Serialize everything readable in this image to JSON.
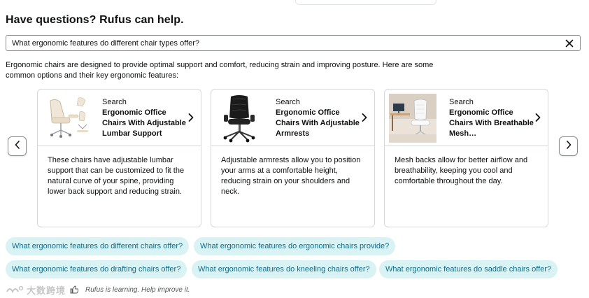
{
  "heading": "Have questions? Rufus can help.",
  "query": {
    "value": "What ergonomic features do different chair types offer?",
    "clear_icon": "close-icon"
  },
  "intro_text": "Ergonomic chairs are designed to provide optimal support and comfort, reducing strain and improving posture. Here are some common options and their key ergonomic features:",
  "cards": [
    {
      "search_label": "Search",
      "title": "Ergonomic Office Chairs With Adjustable Lumbar Support",
      "description": "These chairs have adjustable lumbar support that can be customized to fit the natural curve of your spine, providing lower back support and reducing strain."
    },
    {
      "search_label": "Search",
      "title": "Ergonomic Office Chairs With Adjustable Armrests",
      "description": "Adjustable armrests allow you to position your arms at a comfortable height, reducing strain on your shoulders and neck."
    },
    {
      "search_label": "Search",
      "title": "Ergonomic Office Chairs With Breathable Mesh…",
      "description": "Mesh backs allow for better airflow and breathability, keeping you cool and comfortable throughout the day."
    }
  ],
  "suggestions": [
    "What ergonomic features do different chairs offer?",
    "What ergonomic features do ergonomic chairs provide?",
    "What ergonomic features do drafting chairs offer?",
    "What ergonomic features do kneeling chairs offer?",
    "What ergonomic features do saddle chairs offer?"
  ],
  "footer": {
    "watermark": "大数跨境",
    "text": "Rufus is learning. Help improve it."
  },
  "colors": {
    "chip_bg": "#d9f2f4",
    "chip_text": "#0f6e8a",
    "border": "#d5d9d9"
  }
}
